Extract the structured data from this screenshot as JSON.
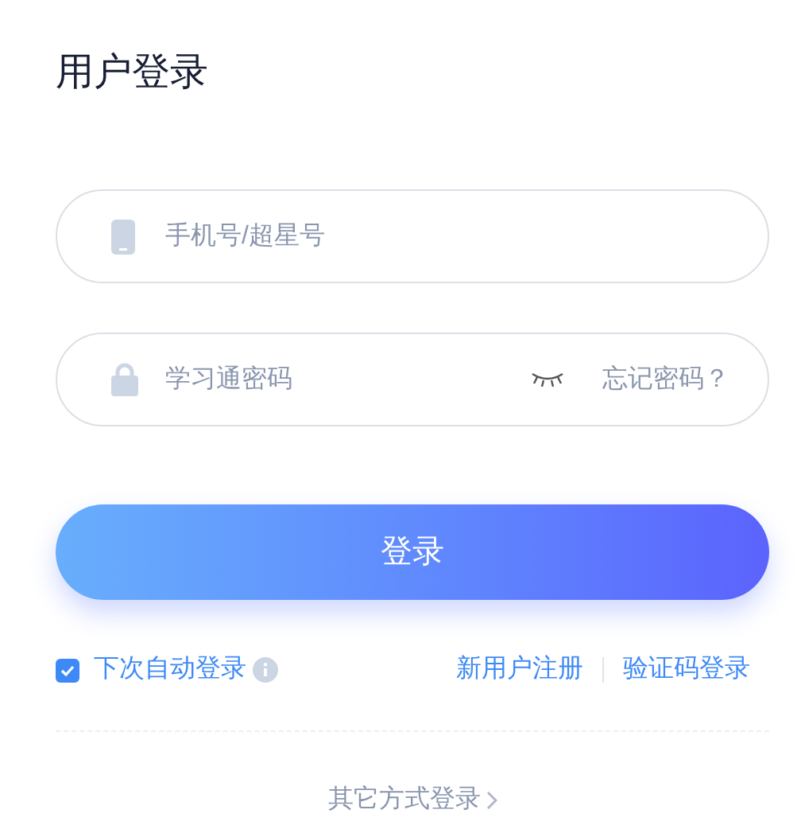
{
  "title": "用户登录",
  "phone_field": {
    "placeholder": "手机号/超星号"
  },
  "password_field": {
    "placeholder": "学习通密码",
    "forgot_link": "忘记密码？"
  },
  "login_button": "登录",
  "remember": {
    "label": "下次自动登录",
    "checked": true
  },
  "links": [
    "新用户注册",
    "验证码登录"
  ],
  "other_login": "其它方式登录"
}
